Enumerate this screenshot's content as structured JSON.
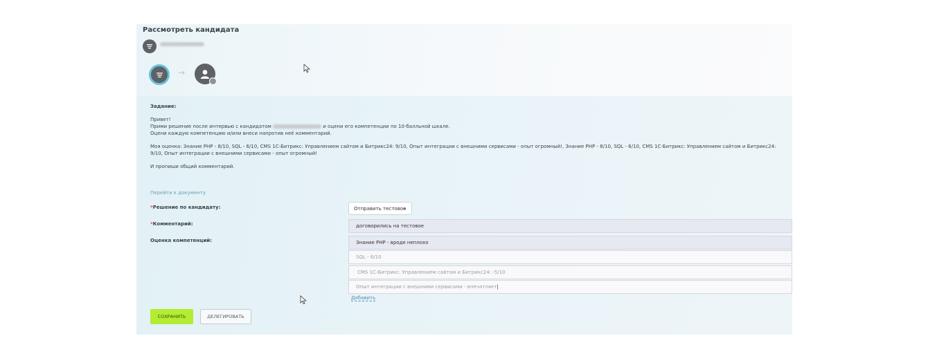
{
  "page_title": "Рассмотреть кандидата",
  "task": {
    "heading": "Задание:",
    "line1_before": "Привет!",
    "line2_before": "Прими решение после интервью с кандидатом",
    "line2_after": "и оцени его компетенции по 10-балльной шкале.",
    "line3": "Оцени каждую компетенцию и/или внеси напротив неё комментарий.",
    "line4": "Моя оценка: Знание PHP - 8/10, SQL - 6/10, CMS 1С-Битрикс: Управлением сайтом и Битрикс24: 9/10, Опыт интеграции с внешними сервисами - опыт огромный!, Знание PHP - 8/10, SQL - 6/10, CMS 1С-Битрикс: Управлением сайтом и Битрикс24: 9/10, Опыт интеграции с внешними сервисами - опыт огромный!",
    "line5": "И пропиши общий комментарий."
  },
  "doc_link": "Перейти к документу",
  "form": {
    "decision_label": "Решение по кандидату:",
    "decision_value": "Отправить тестовое",
    "comment_label": "Комментарий:",
    "comment_value": "договорились на тестовое",
    "competencies_label": "Оценка компетенций:",
    "competencies": [
      "Знание PHP - вроде неплохо",
      "SQL - 6/10",
      "CMS 1С-Битрикс: Управлением сайтом и Битрикс24: -5/10",
      "Опыт интеграции с внешними сервисами - впечатляет"
    ],
    "required_mark": "*",
    "add_link": "Добавить"
  },
  "buttons": {
    "save": "СОХРАНИТЬ",
    "delegate": "ДЕЛЕГИРОВАТЬ"
  },
  "colors": {
    "accent_green": "#b3ec32",
    "step_ring": "#67c2dc",
    "avatar_gray": "#5e6166",
    "link_blue": "#4f8fb2"
  },
  "icons": {
    "header": "list-icon",
    "step1": "list-icon",
    "step2": "user-icon",
    "cursor": "mouse-pointer-icon"
  }
}
